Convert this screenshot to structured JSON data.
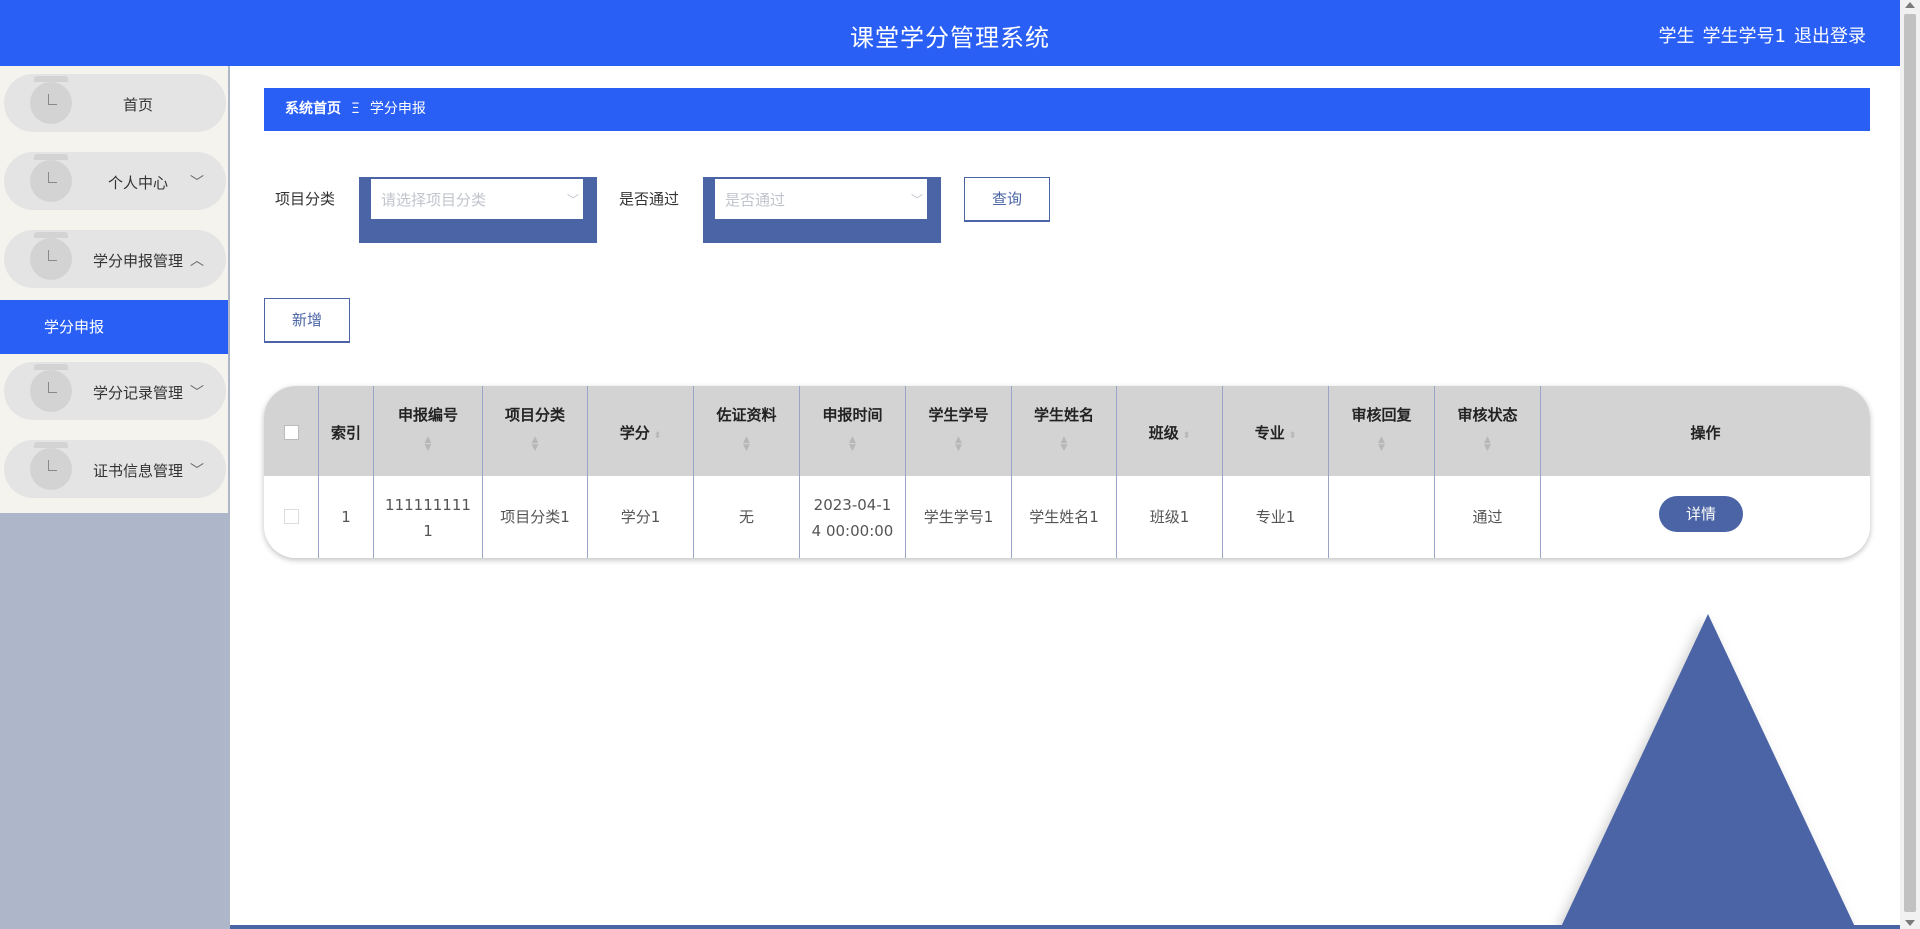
{
  "header": {
    "title": "课堂学分管理系统",
    "role": "学生",
    "username": "学生学号1",
    "logout": "退出登录"
  },
  "sidebar": {
    "items": [
      {
        "label": "首页",
        "chevron": ""
      },
      {
        "label": "个人中心",
        "chevron": "﹀"
      },
      {
        "label": "学分申报管理",
        "chevron": "︿",
        "children": [
          {
            "label": "学分申报",
            "active": true
          }
        ]
      },
      {
        "label": "学分记录管理",
        "chevron": "﹀"
      },
      {
        "label": "证书信息管理",
        "chevron": "﹀"
      }
    ]
  },
  "breadcrumb": {
    "home": "系统首页",
    "separator": "Ξ",
    "current": "学分申报"
  },
  "filters": {
    "category_label": "项目分类",
    "category_placeholder": "请选择项目分类",
    "passed_label": "是否通过",
    "passed_placeholder": "是否通过",
    "search_button": "查询"
  },
  "actions": {
    "add_button": "新增"
  },
  "table": {
    "columns": [
      "索引",
      "申报编号",
      "项目分类",
      "学分",
      "佐证资料",
      "申报时间",
      "学生学号",
      "学生姓名",
      "班级",
      "专业",
      "审核回复",
      "审核状态",
      "操作"
    ],
    "rows": [
      {
        "index": "1",
        "report_no_line1": "111111111",
        "report_no_line2": "1",
        "category": "项目分类1",
        "credit": "学分1",
        "evidence": "无",
        "time_line1": "2023-04-1",
        "time_line2": "4 00:00:00",
        "student_no": "学生学号1",
        "student_name": "学生姓名1",
        "class": "班级1",
        "major": "专业1",
        "reply": "",
        "status": "通过",
        "detail_button": "详情"
      }
    ]
  },
  "icons": {
    "sort": "sort-caret-icon",
    "chevron": "chevron-icon",
    "menu": "menu-knob-icon"
  },
  "colors": {
    "primary": "#2a5ff6",
    "accent": "#4a64a5",
    "sidebar_bg": "#aeb6ca"
  }
}
